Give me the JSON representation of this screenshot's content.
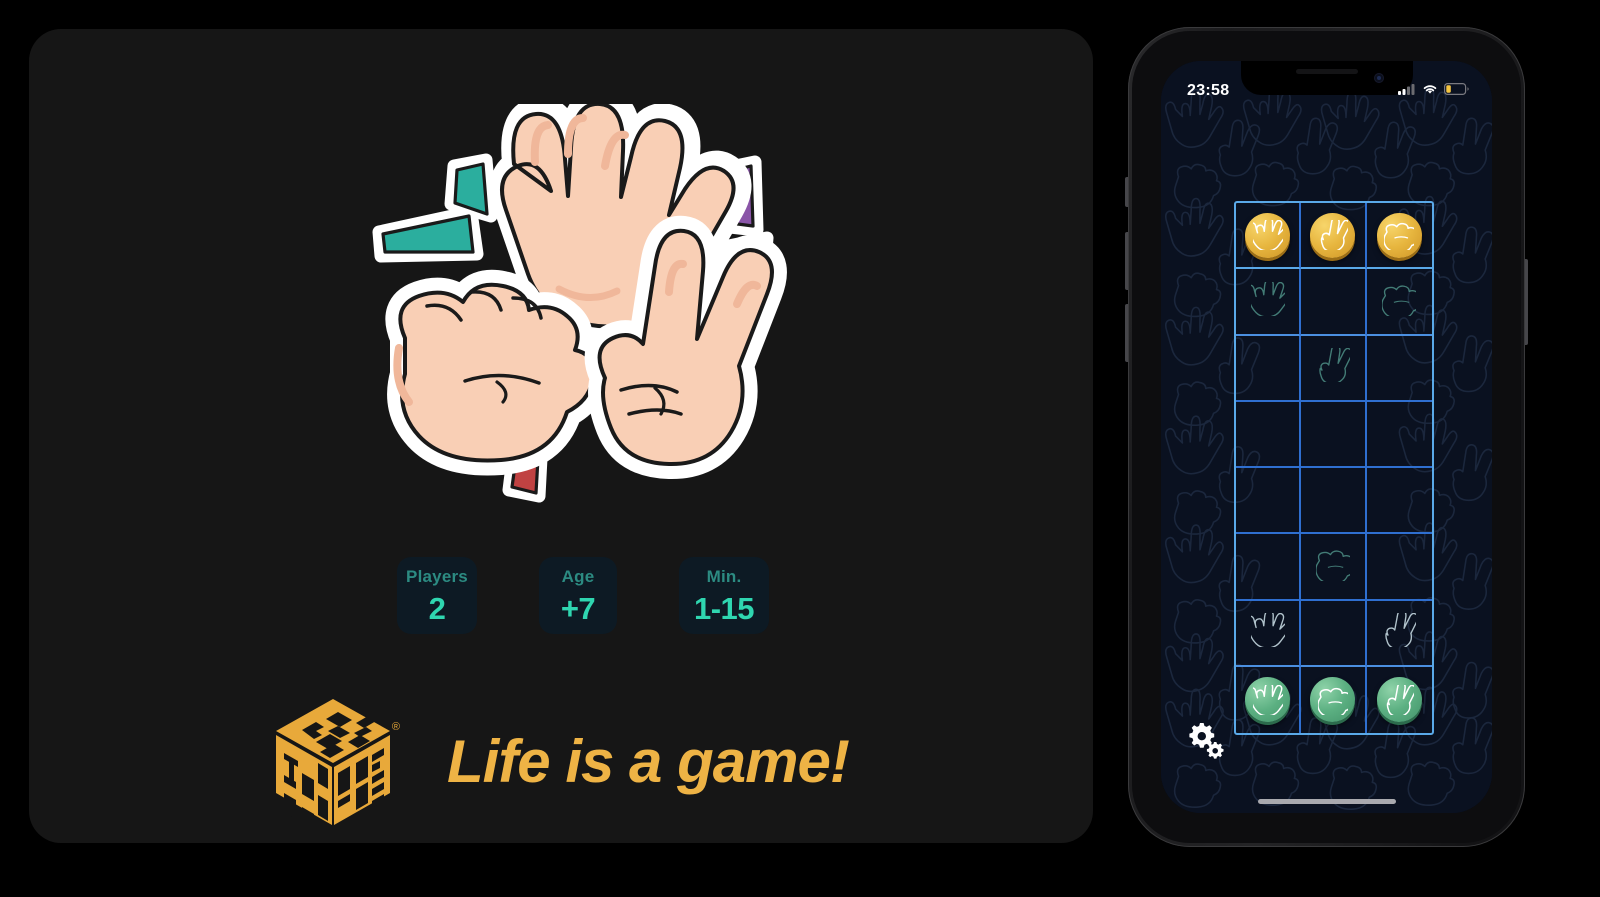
{
  "promo": {
    "illustration": {
      "name": "rock-paper-scissors-hands",
      "hands": [
        "open-palm-paper",
        "fist-rock",
        "peace-sign-scissors"
      ],
      "accent_colors": [
        "#2bae9e",
        "#8a55a8",
        "#c04242"
      ]
    },
    "stats": [
      {
        "id": "players",
        "label": "Players",
        "value": "2"
      },
      {
        "id": "age",
        "label": "Age",
        "value": "+7"
      },
      {
        "id": "minutes",
        "label": "Min.",
        "value": "1-15"
      }
    ],
    "brand": {
      "logo_name": "tasdome-cube-logo",
      "registered_mark": "®",
      "tagline": "Life is a game!"
    },
    "colors": {
      "card_bg": "#161616",
      "pill_bg": "#0d1a24",
      "pill_label": "#2c8b82",
      "pill_value": "#2fd6b0",
      "brand_amber": "#eeb345"
    }
  },
  "phone": {
    "status_bar": {
      "time": "23:58",
      "cellular_icon": "signal-bars-icon",
      "wifi_icon": "wifi-icon",
      "battery_icon": "battery-low-icon",
      "battery_color": "#f5c542"
    },
    "screen": {
      "background": "#0a1120",
      "wallpaper_pattern": "hand-outlines-pattern",
      "settings_icon": "gears-icon",
      "home_indicator": "home-indicator"
    },
    "board": {
      "columns": 3,
      "rows": 8,
      "border_color": "#5aa9e8",
      "grid_line_color": "#2f6fd0",
      "gold_token_color": "#e7b63f",
      "green_token_color": "#5cb082",
      "cells": [
        [
          {
            "type": "token",
            "owner": "gold",
            "gesture": "paper"
          },
          {
            "type": "token",
            "owner": "gold",
            "gesture": "scissors"
          },
          {
            "type": "token",
            "owner": "gold",
            "gesture": "rock"
          }
        ],
        [
          {
            "type": "ghost",
            "gesture": "paper"
          },
          {
            "type": "empty",
            "gesture": null
          },
          {
            "type": "ghost",
            "gesture": "rock"
          }
        ],
        [
          {
            "type": "empty",
            "gesture": null
          },
          {
            "type": "ghost",
            "gesture": "scissors"
          },
          {
            "type": "empty",
            "gesture": null
          }
        ],
        [
          {
            "type": "empty",
            "gesture": null
          },
          {
            "type": "empty",
            "gesture": null
          },
          {
            "type": "empty",
            "gesture": null
          }
        ],
        [
          {
            "type": "empty",
            "gesture": null
          },
          {
            "type": "empty",
            "gesture": null
          },
          {
            "type": "empty",
            "gesture": null
          }
        ],
        [
          {
            "type": "empty",
            "gesture": null
          },
          {
            "type": "ghost",
            "gesture": "rock"
          },
          {
            "type": "empty",
            "gesture": null
          }
        ],
        [
          {
            "type": "ghost",
            "gesture": "paper"
          },
          {
            "type": "empty",
            "gesture": null
          },
          {
            "type": "ghost",
            "gesture": "scissors"
          }
        ],
        [
          {
            "type": "token",
            "owner": "green",
            "gesture": "paper"
          },
          {
            "type": "token",
            "owner": "green",
            "gesture": "rock"
          },
          {
            "type": "token",
            "owner": "green",
            "gesture": "scissors"
          }
        ]
      ]
    }
  }
}
